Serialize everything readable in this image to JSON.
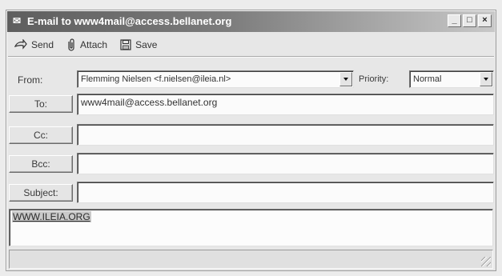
{
  "window": {
    "title": "E-mail to www4mail@access.bellanet.org",
    "minimize": "_",
    "maximize": "□",
    "close": "×"
  },
  "toolbar": {
    "send_label": "Send",
    "attach_label": "Attach",
    "save_label": "Save"
  },
  "form": {
    "from_label": "From:",
    "from_value": "Flemming Nielsen <f.nielsen@ileia.nl>",
    "priority_label": "Priority:",
    "priority_value": "Normal",
    "to_label": "To:",
    "to_value": "www4mail@access.bellanet.org",
    "cc_label": "Cc:",
    "cc_value": "",
    "bcc_label": "Bcc:",
    "bcc_value": "",
    "subject_label": "Subject:",
    "subject_value": ""
  },
  "message": {
    "body_text": "WWW.ILEIA.ORG"
  },
  "icons": {
    "title": "envelope-pen-icon",
    "send": "send-arrow-icon",
    "attach": "paperclip-icon",
    "save": "floppy-disk-icon",
    "dropdown": "chevron-down-icon",
    "resize": "resize-grip-icon"
  }
}
